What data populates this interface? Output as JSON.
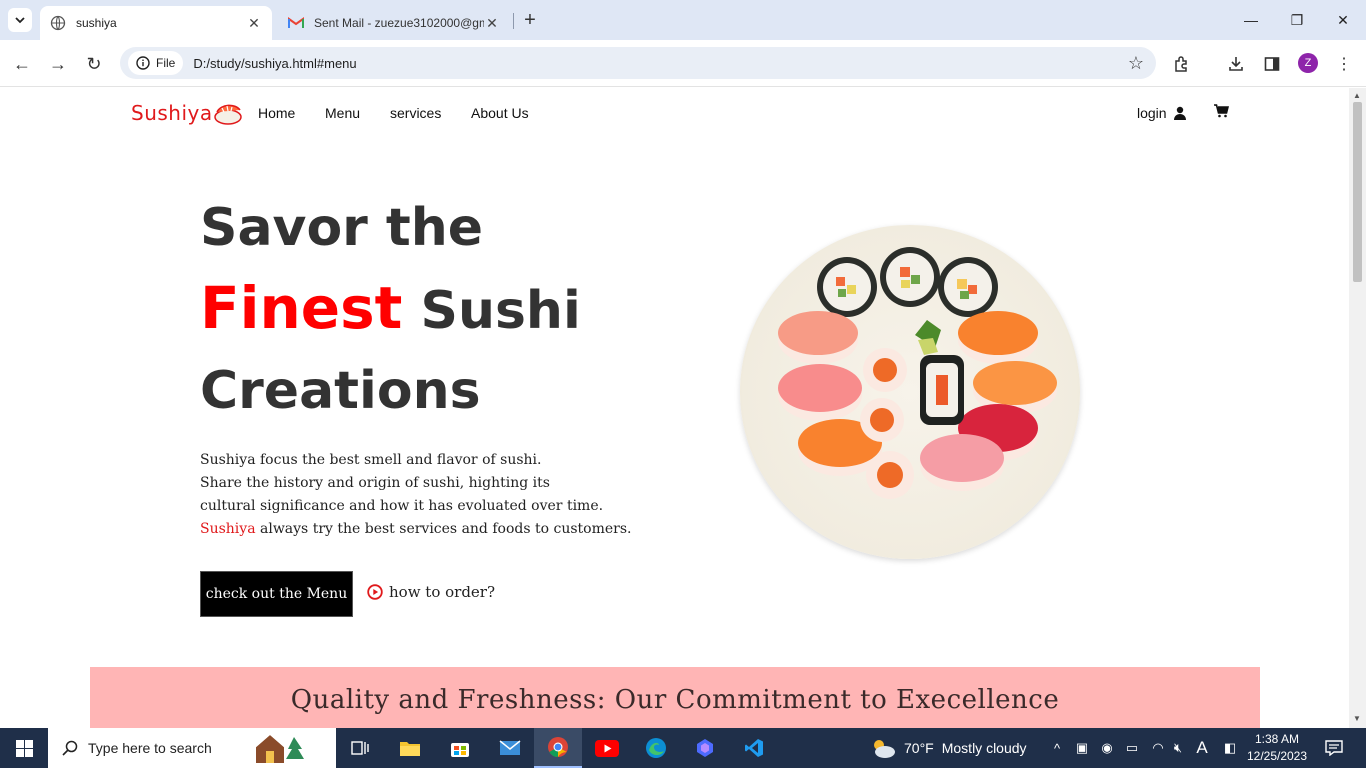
{
  "browser": {
    "tabs": [
      {
        "title": "sushiya",
        "active": true
      },
      {
        "title": "Sent Mail - zuezue3102000@gm",
        "active": false
      }
    ],
    "address": {
      "chip": "File",
      "url": "D:/study/sushiya.html#menu"
    },
    "profile_initial": "Z"
  },
  "site": {
    "logo": "Sushiya",
    "nav": [
      "Home",
      "Menu",
      "services",
      "About Us"
    ],
    "login": "login",
    "hero": {
      "line1": "Savor the",
      "accent": "Finest",
      "line2_rest": "Sushi",
      "line3": "Creations"
    },
    "description": [
      "Sushiya focus the best smell and flavor of sushi.",
      "Share the history and origin of sushi, highting its",
      "cultural significance and how it has evoluated over time."
    ],
    "description_last": {
      "brand": "Sushiya",
      "rest": " always try the best services and foods to customers."
    },
    "cta": "check out the Menu",
    "how_to": "how to order?",
    "banner_title": "Quality and Freshness: Our Commitment to Execellence"
  },
  "taskbar": {
    "search_placeholder": "Type here to search",
    "weather_temp": "70°F",
    "weather_text": "Mostly cloudy",
    "time": "1:38 AM",
    "date": "12/25/2023"
  },
  "colors": {
    "brand_red": "#ff0000",
    "banner_pink": "#ffb5b5"
  }
}
